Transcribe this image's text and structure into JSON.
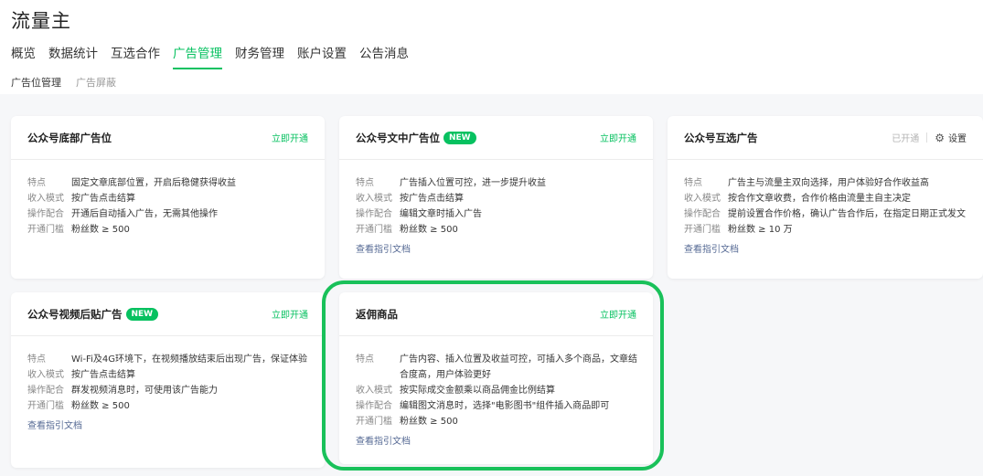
{
  "app": {
    "title": "流量主"
  },
  "nav": {
    "items": [
      {
        "label": "概览",
        "active": false
      },
      {
        "label": "数据统计",
        "active": false
      },
      {
        "label": "互选合作",
        "active": false
      },
      {
        "label": "广告管理",
        "active": true
      },
      {
        "label": "财务管理",
        "active": false
      },
      {
        "label": "账户设置",
        "active": false
      },
      {
        "label": "公告消息",
        "active": false
      }
    ]
  },
  "subnav": {
    "items": [
      {
        "label": "广告位管理",
        "active": true
      },
      {
        "label": "广告屏蔽",
        "active": false
      }
    ]
  },
  "colors": {
    "accent": "#07c160",
    "link": "#576b95",
    "highlight_ring": "#19c15a"
  },
  "cards": [
    {
      "title": "公众号底部广告位",
      "action": "立即开通",
      "rows": [
        {
          "label": "特点",
          "value": "固定文章底部位置，开启后稳健获得收益"
        },
        {
          "label": "收入模式",
          "value": "按广告点击结算"
        },
        {
          "label": "操作配合",
          "value": "开通后自动插入广告，无需其他操作"
        },
        {
          "label": "开通门槛",
          "value": "粉丝数 ≥ 500"
        }
      ]
    },
    {
      "title": "公众号文中广告位",
      "badge": "NEW",
      "action": "立即开通",
      "rows": [
        {
          "label": "特点",
          "value": "广告插入位置可控，进一步提升收益"
        },
        {
          "label": "收入模式",
          "value": "按广告点击结算"
        },
        {
          "label": "操作配合",
          "value": "编辑文章时插入广告"
        },
        {
          "label": "开通门槛",
          "value": "粉丝数 ≥ 500"
        }
      ],
      "doc_link": "查看指引文档"
    },
    {
      "title": "公众号互选广告",
      "status": "已开通",
      "settings": "设置",
      "settings_icon": "gear-icon",
      "rows": [
        {
          "label": "特点",
          "value": "广告主与流量主双向选择，用户体验好合作收益高"
        },
        {
          "label": "收入模式",
          "value": "按合作文章收费，合作价格由流量主自主决定"
        },
        {
          "label": "操作配合",
          "value": "提前设置合作价格，确认广告合作后，在指定日期正式发文"
        },
        {
          "label": "开通门槛",
          "value": "粉丝数 ≥ 10 万"
        }
      ],
      "doc_link": "查看指引文档"
    },
    {
      "title": "公众号视频后贴广告",
      "badge": "NEW",
      "action": "立即开通",
      "rows": [
        {
          "label": "特点",
          "value": "Wi-Fi及4G环境下，在视频播放结束后出现广告，保证体验"
        },
        {
          "label": "收入模式",
          "value": "按广告点击结算"
        },
        {
          "label": "操作配合",
          "value": "群发视频消息时，可使用该广告能力"
        },
        {
          "label": "开通门槛",
          "value": "粉丝数 ≥ 500"
        }
      ],
      "doc_link": "查看指引文档"
    },
    {
      "title": "返佣商品",
      "action": "立即开通",
      "rows": [
        {
          "label": "特点",
          "value": "广告内容、插入位置及收益可控，可插入多个商品，文章结合度高，用户体验更好"
        },
        {
          "label": "收入模式",
          "value": "按实际成交金额乘以商品佣金比例结算"
        },
        {
          "label": "操作配合",
          "value": "编辑图文消息时，选择\"电影图书\"组件插入商品即可"
        },
        {
          "label": "开通门槛",
          "value": "粉丝数 ≥ 500"
        }
      ],
      "doc_link": "查看指引文档"
    }
  ]
}
